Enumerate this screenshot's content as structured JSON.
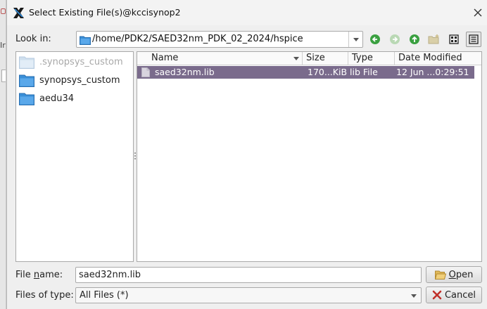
{
  "dialog": {
    "title": "Select Existing File(s)@kccisynop2"
  },
  "lookin": {
    "label": "Look in:",
    "path": "/home/PDK2/SAED32nm_PDK_02_2024/hspice"
  },
  "toolbar": {
    "icons": [
      "back-icon",
      "forward-icon",
      "parent-dir-icon",
      "new-folder-icon",
      "list-view-icon",
      "detail-view-icon"
    ]
  },
  "sidebar": {
    "items": [
      {
        "label": ".synopsys_custom",
        "dimmed": true
      },
      {
        "label": "synopsys_custom",
        "dimmed": false
      },
      {
        "label": "aedu34",
        "dimmed": false
      }
    ]
  },
  "files": {
    "columns": [
      "Name",
      "Size",
      "Type",
      "Date Modified"
    ],
    "rows": [
      {
        "name": "saed32nm.lib",
        "size": "170...KiB",
        "type": "lib File",
        "modified": "12 Jun ...0:29:51",
        "selected": true
      }
    ]
  },
  "filename": {
    "label_pre": "File ",
    "label_key": "n",
    "label_post": "ame:",
    "value": "saed32nm.lib"
  },
  "filetype": {
    "label": "Files of type:",
    "value": "All Files (*)"
  },
  "buttons": {
    "open_key": "O",
    "open_rest": "pen",
    "cancel": "Cancel"
  },
  "colors": {
    "selection": "#7a6b8c",
    "folder": "#3a8fd8",
    "nav_green": "#3aa040"
  }
}
